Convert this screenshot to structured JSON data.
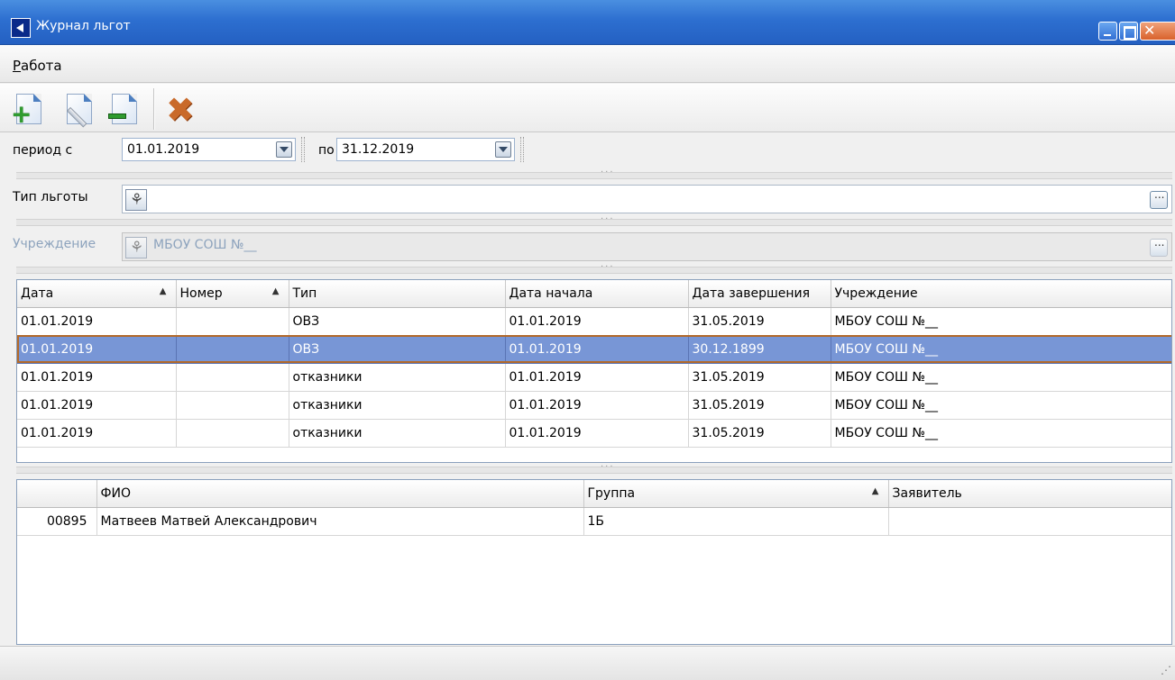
{
  "window": {
    "title": "Журнал льгот"
  },
  "menu": {
    "work_label": "Работа"
  },
  "toolbar": {
    "buttons": [
      {
        "name": "add",
        "icon": "add-document-icon"
      },
      {
        "name": "edit",
        "icon": "edit-document-icon"
      },
      {
        "name": "delete",
        "icon": "remove-document-icon"
      },
      {
        "name": "cancel",
        "icon": "cancel-x-icon"
      }
    ]
  },
  "filters": {
    "period_label": "период с",
    "date_from": "01.01.2019",
    "to_label": "по",
    "date_to": "31.12.2019",
    "benefit_type_label": "Тип льготы",
    "benefit_type_value": "",
    "institution_label": "Учреждение",
    "institution_value": "МБОУ СОШ №__"
  },
  "benefits": {
    "columns": [
      "Дата",
      "Номер",
      "Тип",
      "Дата начала",
      "Дата завершения",
      "Учреждение"
    ],
    "rows": [
      [
        "01.01.2019",
        "",
        "ОВЗ",
        "01.01.2019",
        "31.05.2019",
        "МБОУ СОШ №__"
      ],
      [
        "01.01.2019",
        "",
        "ОВЗ",
        "01.01.2019",
        "30.12.1899",
        "МБОУ СОШ №__"
      ],
      [
        "01.01.2019",
        "",
        "отказники",
        "01.01.2019",
        "31.05.2019",
        "МБОУ СОШ №__"
      ],
      [
        "01.01.2019",
        "",
        "отказники",
        "01.01.2019",
        "31.05.2019",
        "МБОУ СОШ №__"
      ],
      [
        "01.01.2019",
        "",
        "отказники",
        "01.01.2019",
        "31.05.2019",
        "МБОУ СОШ №__"
      ]
    ],
    "selected_row": 1
  },
  "students": {
    "columns": [
      "",
      "ФИО",
      "Группа",
      "Заявитель"
    ],
    "rows": [
      [
        "00895",
        "Матвеев Матвей Александрович",
        "1Б",
        ""
      ]
    ]
  },
  "colors": {
    "titlebar": "#2d6fd0",
    "selection": "#7896d6",
    "selection_border": "#b2692a"
  }
}
